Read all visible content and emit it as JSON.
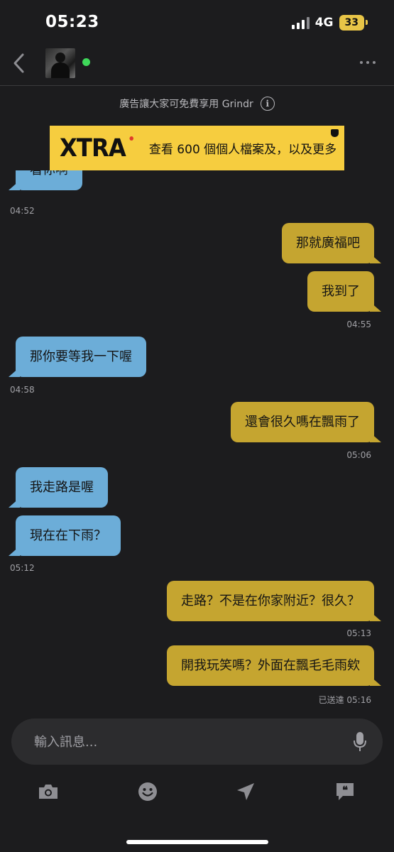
{
  "status_bar": {
    "time": "05:23",
    "network": "4G",
    "battery": "33"
  },
  "header": {
    "back_icon": "chevron-left-icon",
    "online": true,
    "more_icon": "ellipsis-icon"
  },
  "ad": {
    "notice": "廣告讓大家可免費享用 Grindr",
    "info_symbol": "i",
    "brand": "XTRA",
    "text": "查看 600 個個人檔案及，以及更多"
  },
  "messages": [
    {
      "dir": "in",
      "text": "看你啊"
    },
    {
      "time": "04:52"
    },
    {
      "dir": "out",
      "text": "那就廣福吧"
    },
    {
      "dir": "out",
      "text": "我到了"
    },
    {
      "time": "04:55"
    },
    {
      "dir": "in",
      "text": "那你要等我一下喔"
    },
    {
      "time": "04:58"
    },
    {
      "dir": "out",
      "text": "還會很久嗎在飄雨了"
    },
    {
      "time": "05:06"
    },
    {
      "dir": "in",
      "text": "我走路是喔"
    },
    {
      "dir": "in",
      "text": "現在在下雨？"
    },
    {
      "time": "05:12"
    },
    {
      "dir": "out",
      "text": "走路？不是在你家附近？很久？"
    },
    {
      "time": "05:13"
    },
    {
      "dir": "out",
      "text": "開我玩笑嗎？外面在飄毛毛雨欸"
    },
    {
      "time": "已送達 05:16"
    }
  ],
  "composer": {
    "placeholder": "輸入訊息..."
  },
  "toolbar": [
    "camera-icon",
    "emoji-icon",
    "location-icon",
    "saved-phrases-icon"
  ],
  "colors": {
    "incoming": "#6cadd8",
    "outgoing": "#c5a530",
    "ad_bg": "#f6cd3f",
    "online": "#3fd85a",
    "background": "#1c1c1e"
  }
}
